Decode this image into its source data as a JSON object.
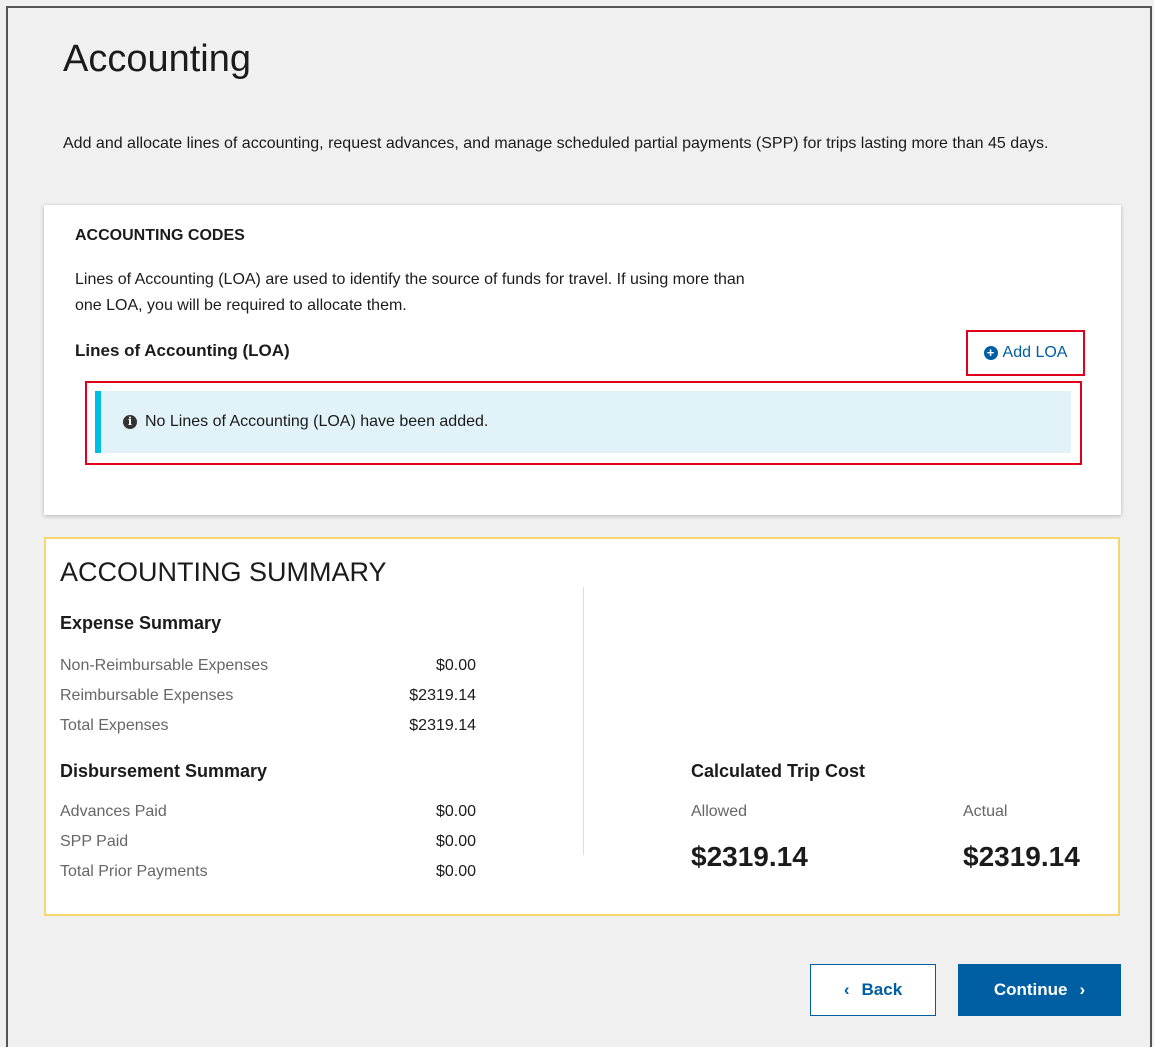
{
  "page": {
    "title": "Accounting",
    "intro": "Add and allocate lines of accounting, request advances, and manage scheduled partial payments (SPP) for trips lasting more than 45 days."
  },
  "codes": {
    "heading": "ACCOUNTING CODES",
    "description": "Lines of Accounting (LOA) are used to identify the source of funds for travel. If using more than one LOA, you will be required to allocate them.",
    "loa_heading": "Lines of Accounting (LOA)",
    "add_loa_label": "Add LOA",
    "empty_message": "No Lines of Accounting (LOA) have been added."
  },
  "summary": {
    "heading": "ACCOUNTING SUMMARY",
    "expense_heading": "Expense Summary",
    "expenses": [
      {
        "label": "Non-Reimbursable Expenses",
        "amount": "$0.00"
      },
      {
        "label": "Reimbursable Expenses",
        "amount": "$2319.14"
      },
      {
        "label": "Total Expenses",
        "amount": "$2319.14"
      }
    ],
    "disbursement_heading": "Disbursement Summary",
    "disbursements": [
      {
        "label": "Advances Paid",
        "amount": "$0.00"
      },
      {
        "label": "SPP Paid",
        "amount": "$0.00"
      },
      {
        "label": "Total Prior Payments",
        "amount": "$0.00"
      }
    ],
    "trip_cost_heading": "Calculated Trip Cost",
    "allowed_label": "Allowed",
    "allowed_value": "$2319.14",
    "actual_label": "Actual",
    "actual_value": "$2319.14"
  },
  "nav": {
    "back_label": "Back",
    "continue_label": "Continue"
  },
  "colors": {
    "primary": "#005ea2",
    "highlight": "#e0001b",
    "summary_border": "#f5d76e",
    "alert_bg": "#e1f3f8",
    "alert_bar": "#00bde3"
  },
  "icons": {
    "add": "plus-circle-icon",
    "info": "info-circle-icon",
    "back": "chevron-left-icon",
    "continue": "chevron-right-icon"
  }
}
